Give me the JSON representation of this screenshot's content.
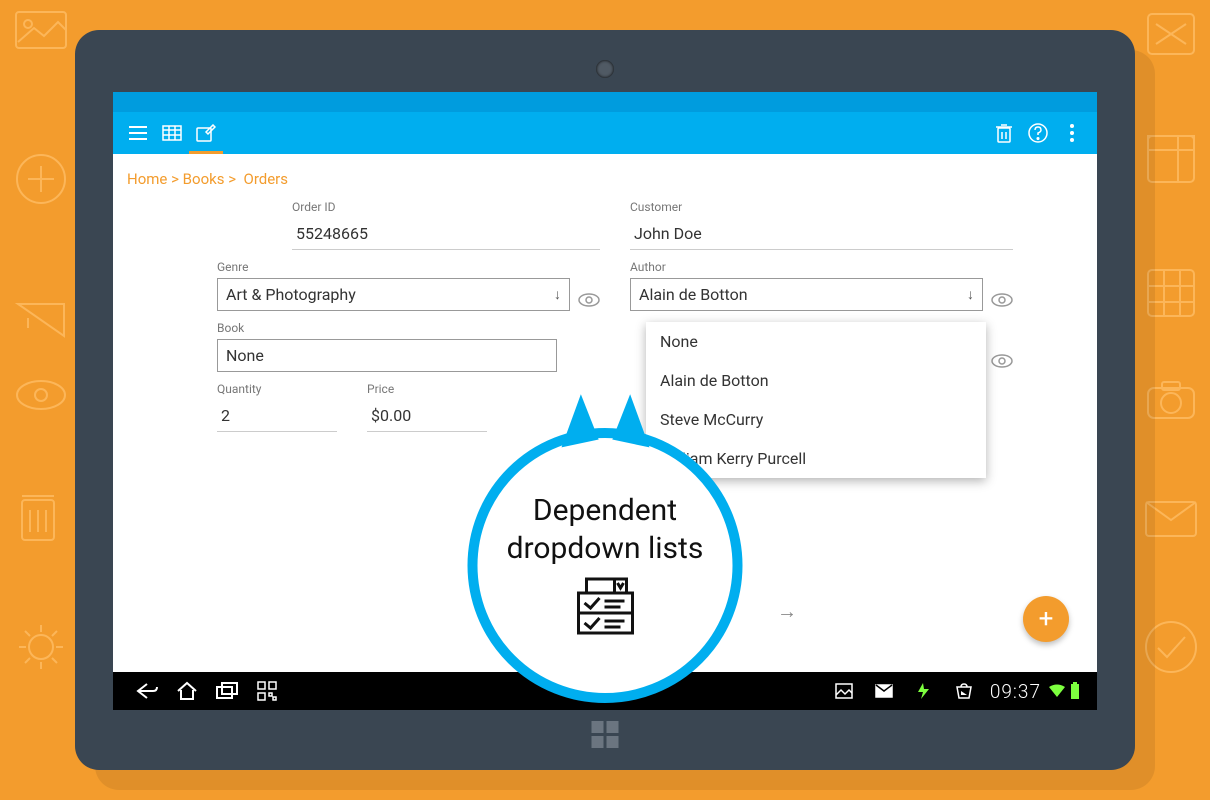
{
  "breadcrumb": [
    "Home",
    "Books",
    "Orders"
  ],
  "toolbar": {
    "menu": "menu",
    "table": "table-view",
    "edit": "edit-view",
    "delete": "delete",
    "help": "help",
    "overflow": "more"
  },
  "form": {
    "order_id": {
      "label": "Order ID",
      "value": "55248665"
    },
    "customer": {
      "label": "Customer",
      "value": "John Doe"
    },
    "genre": {
      "label": "Genre",
      "value": "Art & Photography"
    },
    "author": {
      "label": "Author",
      "value": "Alain de Botton"
    },
    "book": {
      "label": "Book",
      "value": "None"
    },
    "quantity": {
      "label": "Quantity",
      "value": "2"
    },
    "price": {
      "label": "Price",
      "value": "$0.00"
    }
  },
  "author_options": [
    "None",
    "Alain de Botton",
    "Steve McCurry",
    "William Kerry Purcell"
  ],
  "callout": {
    "line1": "Dependent",
    "line2": "dropdown lists"
  },
  "clock": "09:37",
  "fab": "+"
}
